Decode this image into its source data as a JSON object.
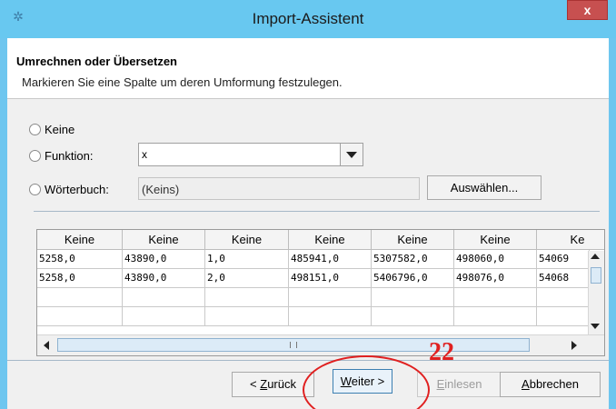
{
  "window": {
    "title": "Import-Assistent",
    "close_label": "x",
    "icon": "gear-icon"
  },
  "header": {
    "title": "Umrechnen oder Übersetzen",
    "subtitle": "Markieren Sie eine Spalte um deren Umformung festzulegen."
  },
  "options": {
    "none_label": "Keine",
    "function_label": "Funktion:",
    "function_value": "x",
    "dictionary_label": "Wörterbuch:",
    "dictionary_value": "(Keins)",
    "choose_button": "Auswählen..."
  },
  "table": {
    "columns": [
      "Keine",
      "Keine",
      "Keine",
      "Keine",
      "Keine",
      "Keine",
      "Ke"
    ],
    "rows": [
      [
        "5258,0",
        "43890,0",
        "1,0",
        "485941,0",
        "5307582,0",
        "498060,0",
        "54069"
      ],
      [
        "5258,0",
        "43890,0",
        "2,0",
        "498151,0",
        "5406796,0",
        "498076,0",
        "54068"
      ]
    ]
  },
  "buttons": {
    "back": {
      "underlined": "Z",
      "rest_before": "< ",
      "rest_after": "urück"
    },
    "next": {
      "underlined": "W",
      "rest_after": "eiter >"
    },
    "read": {
      "underlined": "E",
      "rest_after": "inlesen"
    },
    "cancel": {
      "underlined": "A",
      "rest_after": "bbrechen"
    }
  },
  "annotation": {
    "number": "22",
    "color": "#e02020"
  }
}
